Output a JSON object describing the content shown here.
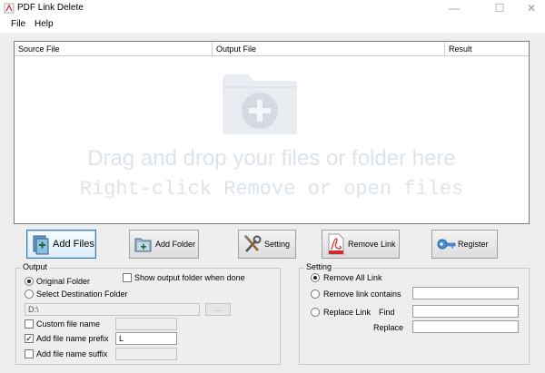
{
  "window": {
    "title": "PDF Link Delete",
    "minimize": "—",
    "maximize": "☐",
    "close": "✕"
  },
  "menu": [
    "File",
    "Help"
  ],
  "table": {
    "columns": [
      "Source File",
      "Output File",
      "Result"
    ],
    "drop_hint": "Drag and drop your files or folder here",
    "context_hint": "Right-click Remove or open files"
  },
  "toolbar": [
    {
      "label": "Add Files",
      "icon": "add-files-icon"
    },
    {
      "label": "Add Folder",
      "icon": "add-folder-icon"
    },
    {
      "label": "Setting",
      "icon": "tools-icon"
    },
    {
      "label": "Remove Link",
      "icon": "pdf-icon"
    },
    {
      "label": "Register",
      "icon": "key-icon"
    }
  ],
  "output": {
    "title": "Output",
    "original_folder": "Original Folder",
    "select_destination": "Select Destination Folder",
    "show_output_folder": "Show output folder when done",
    "destination_path": "D:\\",
    "browse_label": "...",
    "custom_file_name": "Custom file name",
    "add_prefix": "Add file name prefix",
    "prefix_value": "L",
    "add_suffix": "Add file name suffix",
    "selected": "Original Folder",
    "prefix_checked": "✓"
  },
  "setting": {
    "title": "Setting",
    "remove_all": "Remove All Link",
    "remove_contains": "Remove link contains",
    "replace_link": "Replace Link",
    "find": "Find",
    "replace": "Replace",
    "selected": "Remove All Link"
  },
  "colors": {
    "accent": "#3c7fb1",
    "hint_text": "#dde3ea",
    "pdf_red": "#d22a2a"
  }
}
